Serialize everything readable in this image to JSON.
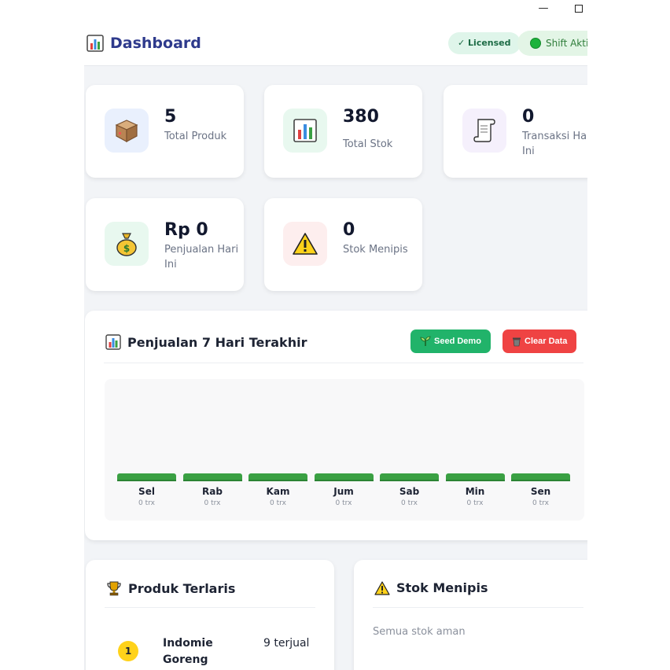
{
  "window": {
    "minimize_glyph": "—"
  },
  "header": {
    "title": "Dashboard",
    "license_badge": "✓ Licensed",
    "shift_badge": "Shift Akti"
  },
  "stats": [
    {
      "value": "5",
      "label": "Total Produk",
      "icon": "package-icon"
    },
    {
      "value": "380",
      "label": "Total Stok",
      "icon": "bar-chart-icon"
    },
    {
      "value": "0",
      "label": "Transaksi Hari Ini",
      "icon": "receipt-scroll-icon"
    },
    {
      "value": "Rp 0",
      "label": "Penjualan Hari Ini",
      "icon": "money-bag-icon"
    },
    {
      "value": "0",
      "label": "Stok Menipis",
      "icon": "warning-icon"
    }
  ],
  "sales_chart": {
    "title": "Penjualan 7 Hari Terakhir",
    "seed_button": "Seed Demo",
    "clear_button": "Clear Data"
  },
  "chart_data": {
    "type": "bar",
    "categories": [
      "Sel",
      "Rab",
      "Kam",
      "Jum",
      "Sab",
      "Min",
      "Sen"
    ],
    "values": [
      0,
      0,
      0,
      0,
      0,
      0,
      0
    ],
    "sub_labels": [
      "0 trx",
      "0 trx",
      "0 trx",
      "0 trx",
      "0 trx",
      "0 trx",
      "0 trx"
    ],
    "title": "Penjualan 7 Hari Terakhir"
  },
  "top_products": {
    "title": "Produk Terlaris",
    "items": [
      {
        "rank": "1",
        "name": "Indomie Goreng",
        "sold": "9 terjual"
      }
    ]
  },
  "low_stock": {
    "title": "Stok Menipis",
    "empty_message": "Semua stok aman"
  },
  "colors": {
    "brand_title": "#2e3a8c",
    "seed_button": "#21b36a",
    "clear_button": "#ef4343",
    "bar": "#3aa043",
    "rank_badge": "#ffd21a"
  }
}
